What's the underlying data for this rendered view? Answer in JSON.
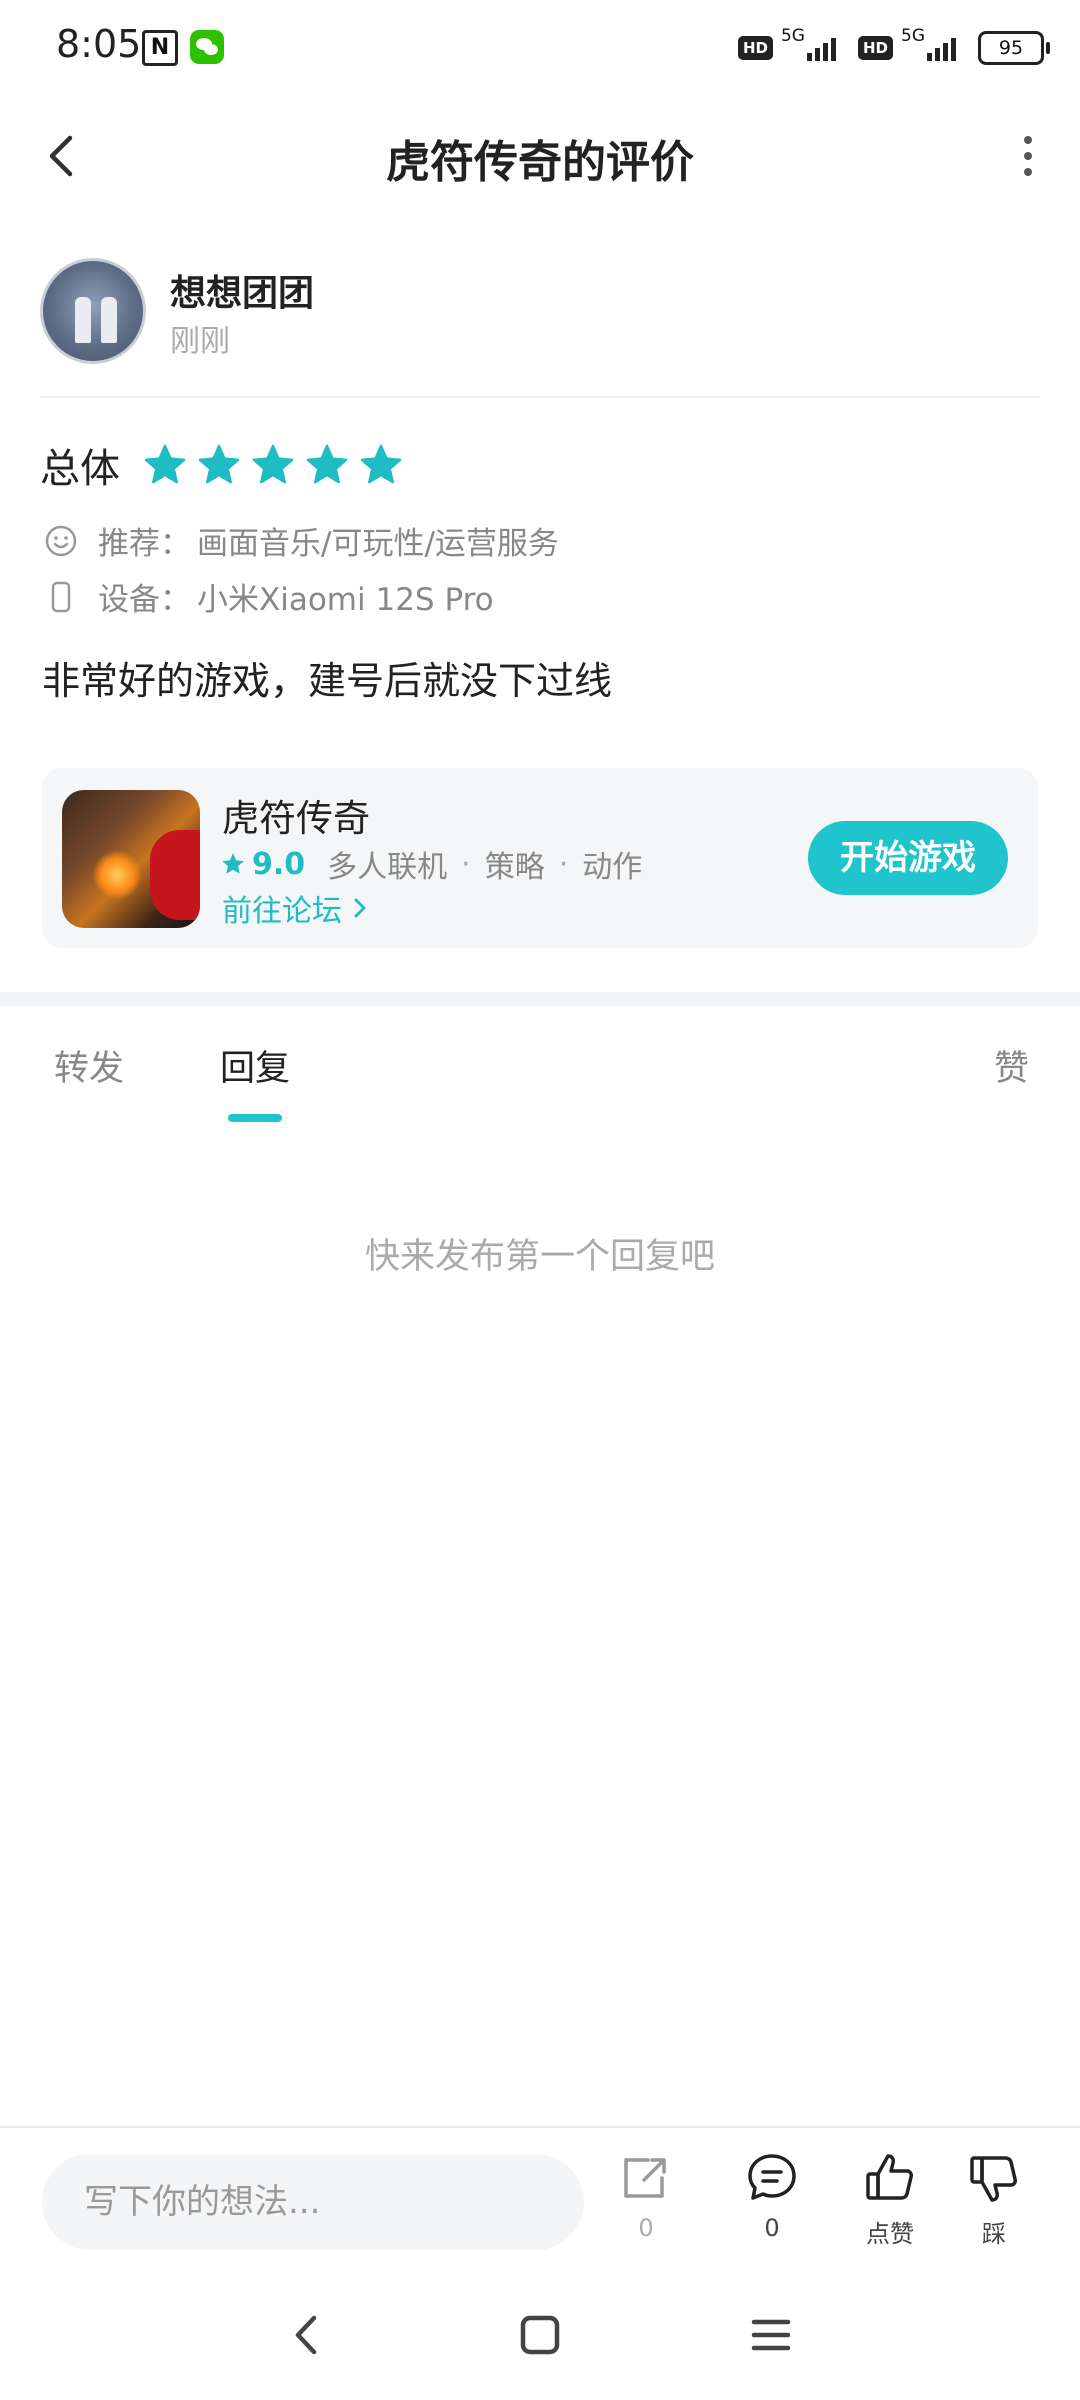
{
  "status_bar": {
    "time": "8:05",
    "network_1": "5G",
    "network_2": "5G",
    "hd_label": "HD",
    "battery": "95"
  },
  "header": {
    "title": "虎符传奇的评价",
    "back_icon": "chevron-left-icon",
    "more_icon": "more-vertical-icon"
  },
  "author": {
    "name": "想想团团",
    "time": "刚刚"
  },
  "rating": {
    "label": "总体",
    "stars": 5,
    "star_color": "#1fbcc4"
  },
  "details": {
    "recommend_label": "推荐：",
    "recommend_value": "画面音乐/可玩性/运营服务",
    "device_label": "设备：",
    "device_value": "小米Xiaomi 12S Pro"
  },
  "review_text": "非常好的游戏，建号后就没下过线",
  "game": {
    "name": "虎符传奇",
    "score": "9.0",
    "tags": [
      "多人联机",
      "策略",
      "动作"
    ],
    "tag_separator": "·",
    "forum_link": "前往论坛",
    "play_button": "开始游戏",
    "accent": "#20c4cc"
  },
  "tabs": {
    "repost": "转发",
    "reply": "回复",
    "like": "赞",
    "active": "reply"
  },
  "empty_state": "快来发布第一个回复吧",
  "bottom_bar": {
    "input_placeholder": "写下你的想法...",
    "share_count": "0",
    "comment_count": "0",
    "like_label": "点赞",
    "dislike_label": "踩"
  }
}
